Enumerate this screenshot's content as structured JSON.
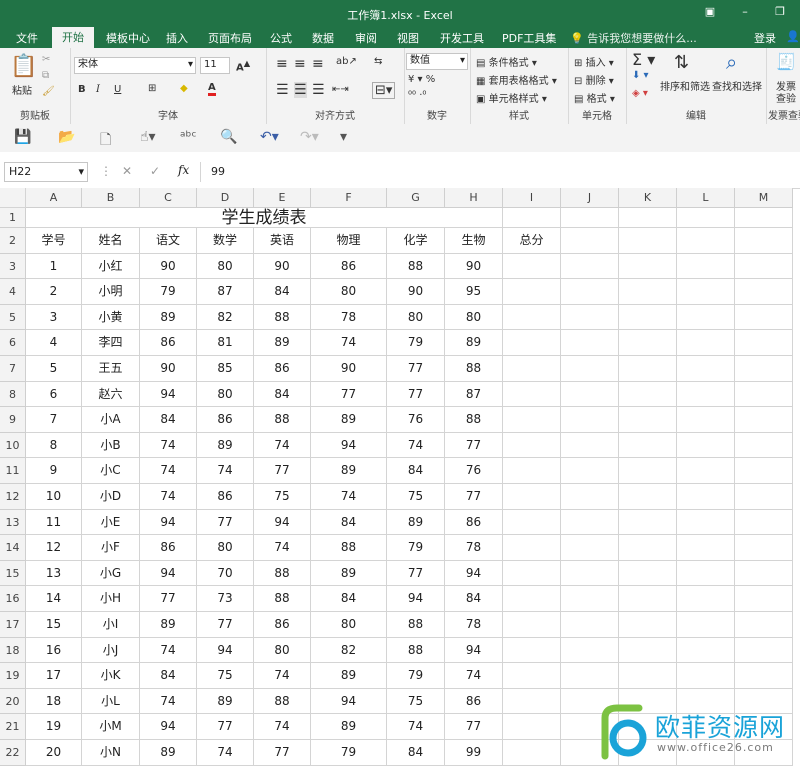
{
  "window": {
    "title": "工作簿1.xlsx - Excel"
  },
  "tabs": [
    "文件",
    "开始",
    "模板中心",
    "插入",
    "页面布局",
    "公式",
    "数据",
    "审阅",
    "视图",
    "开发工具",
    "PDF工具集"
  ],
  "tell_me": "告诉我您想要做什么...",
  "login": "登录",
  "ribbon": {
    "clipboard": {
      "paste": "粘贴",
      "label": "剪贴板"
    },
    "font": {
      "name": "宋体",
      "size": "11",
      "bold": "B",
      "italic": "I",
      "underline": "U",
      "font_color_glyph": "A",
      "label": "字体"
    },
    "alignment": {
      "label": "对齐方式"
    },
    "number": {
      "format": "数值",
      "label": "数字"
    },
    "styles": {
      "conditional": "条件格式",
      "table": "套用表格格式",
      "cell": "单元格样式",
      "label": "样式"
    },
    "cells": {
      "insert": "插入",
      "delete": "删除",
      "format": "格式",
      "label": "单元格"
    },
    "editing": {
      "sort_filter": "排序和筛选",
      "find_select": "查找和选择",
      "label": "编辑"
    },
    "invoice": {
      "line1": "发票",
      "line2": "查验",
      "label": "发票查验"
    }
  },
  "formula_bar": {
    "name_box": "H22",
    "fx_label": "fx",
    "value": "99"
  },
  "columns": [
    "A",
    "B",
    "C",
    "D",
    "E",
    "F",
    "G",
    "H",
    "I",
    "J",
    "K",
    "L",
    "M"
  ],
  "sheet": {
    "title": "学生成绩表",
    "headers": [
      "学号",
      "姓名",
      "语文",
      "数学",
      "英语",
      "物理",
      "化学",
      "生物",
      "总分"
    ],
    "rows": [
      [
        "1",
        "小红",
        "90",
        "80",
        "90",
        "86",
        "88",
        "90"
      ],
      [
        "2",
        "小明",
        "79",
        "87",
        "84",
        "80",
        "90",
        "95"
      ],
      [
        "3",
        "小黄",
        "89",
        "82",
        "88",
        "78",
        "80",
        "80"
      ],
      [
        "4",
        "李四",
        "86",
        "81",
        "89",
        "74",
        "79",
        "89"
      ],
      [
        "5",
        "王五",
        "90",
        "85",
        "86",
        "90",
        "77",
        "88"
      ],
      [
        "6",
        "赵六",
        "94",
        "80",
        "84",
        "77",
        "77",
        "87"
      ],
      [
        "7",
        "小A",
        "84",
        "86",
        "88",
        "89",
        "76",
        "88"
      ],
      [
        "8",
        "小B",
        "74",
        "89",
        "74",
        "94",
        "74",
        "77"
      ],
      [
        "9",
        "小C",
        "74",
        "74",
        "77",
        "89",
        "84",
        "76"
      ],
      [
        "10",
        "小D",
        "74",
        "86",
        "75",
        "74",
        "75",
        "77"
      ],
      [
        "11",
        "小E",
        "94",
        "77",
        "94",
        "84",
        "89",
        "86"
      ],
      [
        "12",
        "小F",
        "86",
        "80",
        "74",
        "88",
        "79",
        "78"
      ],
      [
        "13",
        "小G",
        "94",
        "70",
        "88",
        "89",
        "77",
        "94"
      ],
      [
        "14",
        "小H",
        "77",
        "73",
        "88",
        "84",
        "94",
        "84"
      ],
      [
        "15",
        "小I",
        "89",
        "77",
        "86",
        "80",
        "88",
        "78"
      ],
      [
        "16",
        "小J",
        "74",
        "94",
        "80",
        "82",
        "88",
        "94"
      ],
      [
        "17",
        "小K",
        "84",
        "75",
        "74",
        "89",
        "79",
        "74"
      ],
      [
        "18",
        "小L",
        "74",
        "89",
        "88",
        "94",
        "75",
        "86"
      ],
      [
        "19",
        "小M",
        "94",
        "77",
        "74",
        "89",
        "74",
        "77"
      ],
      [
        "20",
        "小N",
        "89",
        "74",
        "77",
        "79",
        "84",
        "99"
      ]
    ]
  },
  "watermark": {
    "name": "欧菲资源网",
    "url": "www.office26.com"
  },
  "colors": {
    "excel_green": "#217346",
    "ribbon_bg": "#f3f3f3",
    "watermark_blue": "#1aa3d8",
    "watermark_green": "#7cc242"
  }
}
